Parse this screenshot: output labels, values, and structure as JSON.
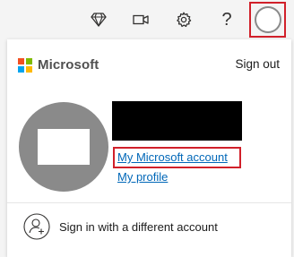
{
  "toolbar": {
    "icons": [
      "diamond-icon",
      "video-icon",
      "gear-icon",
      "help-icon"
    ],
    "help_label": "?"
  },
  "account_panel": {
    "brand": "Microsoft",
    "sign_out": "Sign out",
    "my_account_link": "My Microsoft account",
    "my_profile_link": "My profile",
    "switch_account": "Sign in with a different account"
  },
  "colors": {
    "logo_red": "#f25022",
    "logo_green": "#7fba00",
    "logo_blue": "#00a4ef",
    "logo_yellow": "#ffb900",
    "link": "#0067b8",
    "highlight": "#d1202a"
  }
}
